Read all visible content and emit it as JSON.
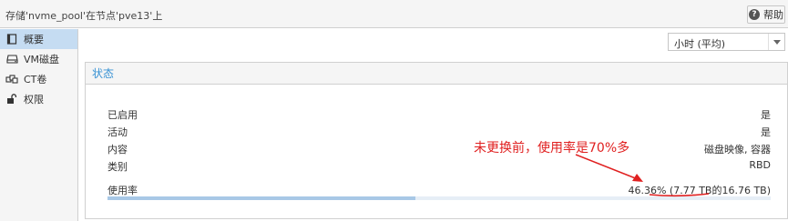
{
  "window": {
    "title": "存储'nvme_pool'在节点'pve13'上",
    "help_label": "帮助"
  },
  "sidebar": {
    "items": [
      {
        "label": "概要",
        "icon": "book-icon",
        "active": true
      },
      {
        "label": "VM磁盘",
        "icon": "hdd-icon",
        "active": false
      },
      {
        "label": "CT卷",
        "icon": "container-icon",
        "active": false
      },
      {
        "label": "权限",
        "icon": "unlock-icon",
        "active": false
      }
    ]
  },
  "timeframe": {
    "selected": "小时 (平均)"
  },
  "status_panel": {
    "title": "状态",
    "rows": [
      {
        "label": "已启用",
        "value": "是"
      },
      {
        "label": "活动",
        "value": "是"
      },
      {
        "label": "内容",
        "value": "磁盘映像, 容器"
      },
      {
        "label": "类别",
        "value": "RBD"
      }
    ],
    "usage": {
      "label": "使用率",
      "value_text": "46.36% (7.77 TB的16.76 TB)",
      "fraction": 0.4636
    }
  },
  "annotation": {
    "text": "未更换前，使用率是70%多",
    "color": "#e02020"
  },
  "colors": {
    "accent": "#3892d4",
    "active_nav": "#c5dcf2",
    "progress_fill": "#a8c8e6"
  }
}
